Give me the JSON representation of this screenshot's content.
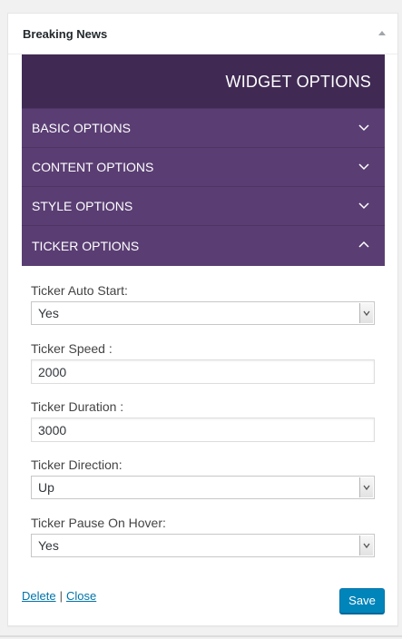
{
  "widget": {
    "title": "Breaking News"
  },
  "panel": {
    "header": "WIDGET OPTIONS",
    "sections": [
      {
        "label": "BASIC OPTIONS",
        "state": "collapsed"
      },
      {
        "label": "CONTENT OPTIONS",
        "state": "collapsed"
      },
      {
        "label": "STYLE OPTIONS",
        "state": "collapsed"
      },
      {
        "label": "TICKER OPTIONS",
        "state": "expanded"
      }
    ]
  },
  "fields": {
    "auto_start": {
      "label": "Ticker Auto Start:",
      "value": "Yes"
    },
    "speed": {
      "label": "Ticker Speed :",
      "value": "2000"
    },
    "duration": {
      "label": "Ticker Duration :",
      "value": "3000"
    },
    "direction": {
      "label": "Ticker Direction:",
      "value": "Up"
    },
    "pause_on_hover": {
      "label": "Ticker Pause On Hover:",
      "value": "Yes"
    }
  },
  "actions": {
    "delete": "Delete",
    "separator": "|",
    "close": "Close",
    "save": "Save"
  },
  "colors": {
    "panel_header": "#402a53",
    "section_bg": "#5a3e73",
    "save_button": "#0085ba",
    "link": "#0073aa"
  },
  "icons": {
    "widget_toggle": "triangle-up-icon",
    "collapsed_section": "chevron-down-icon",
    "expanded_section": "chevron-up-icon",
    "select_arrow": "caret-down-icon"
  }
}
